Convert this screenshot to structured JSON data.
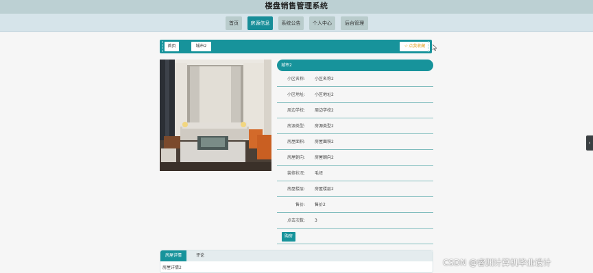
{
  "header": {
    "title": "楼盘销售管理系统"
  },
  "nav": {
    "items": [
      {
        "label": "首页"
      },
      {
        "label": "房源信息"
      },
      {
        "label": "系统公告"
      },
      {
        "label": "个人中心"
      },
      {
        "label": "后台管理"
      }
    ],
    "active_index": 1
  },
  "breadcrumb": {
    "home": "首页",
    "current": "城市2",
    "favorite": "点我收藏"
  },
  "detail": {
    "panel_title": "城市2",
    "fields": [
      {
        "label": "小区名称:",
        "value": "小区名称2"
      },
      {
        "label": "小区地址:",
        "value": "小区地址2"
      },
      {
        "label": "周边学校:",
        "value": "周边学校2"
      },
      {
        "label": "房源类型:",
        "value": "房源类型2"
      },
      {
        "label": "房屋面积:",
        "value": "房屋面积2"
      },
      {
        "label": "房屋朝向:",
        "value": "房屋朝向2"
      },
      {
        "label": "装修状况:",
        "value": "毛坯"
      },
      {
        "label": "房屋楼层:",
        "value": "房屋楼层2"
      },
      {
        "label": "售价:",
        "value": "售价2"
      },
      {
        "label": "点击次数:",
        "value": "3"
      }
    ],
    "buy_label": "购房"
  },
  "tabs": {
    "items": [
      {
        "label": "房屋详情"
      },
      {
        "label": "评论"
      }
    ],
    "active_index": 0,
    "content": "房屋详情2"
  },
  "side_arrow": "‹",
  "watermark": "CSDN @睿渊计算机毕业设计",
  "colors": {
    "accent": "#17939b",
    "header_bg": "#bcd0d3",
    "nav_bg": "#d6e4ea",
    "favorite": "#e8a317"
  }
}
